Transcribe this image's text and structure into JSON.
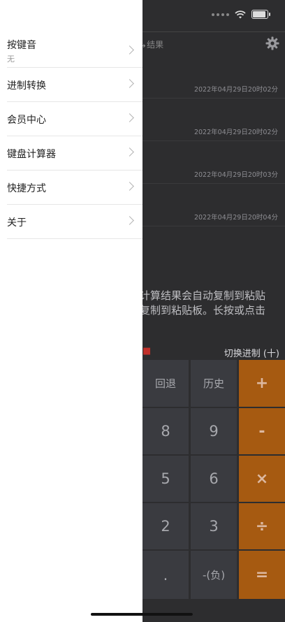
{
  "drawer": {
    "items": [
      {
        "label": "按键音",
        "sub": "无"
      },
      {
        "label": "进制转换"
      },
      {
        "label": "会员中心"
      },
      {
        "label": "键盘计算器"
      },
      {
        "label": "快捷方式"
      },
      {
        "label": "关于"
      }
    ]
  },
  "app": {
    "header_title": "结果",
    "history": [
      {
        "time": "2022年04月29日20时02分"
      },
      {
        "time": "2022年04月29日20时02分"
      },
      {
        "time": "2022年04月29日20时03分"
      },
      {
        "time": "2022年04月29日20时04分"
      }
    ],
    "hint_line1": "计算结果会自动复制到粘贴",
    "hint_line2": "复制到粘贴板。长按或点击",
    "mode_switch": "切换进制 (十)",
    "keys": {
      "backspace": "回退",
      "history": "历史",
      "plus": "+",
      "eight": "8",
      "nine": "9",
      "minus": "-",
      "five": "5",
      "six": "6",
      "multiply": "×",
      "two": "2",
      "three": "3",
      "divide": "÷",
      "dot": ".",
      "negative": "-(负)",
      "equals": "="
    }
  },
  "colors": {
    "operator_key": "#a65a11",
    "number_key": "#3a3b40",
    "background": "#2d2d2f",
    "drawer": "#ffffff"
  }
}
